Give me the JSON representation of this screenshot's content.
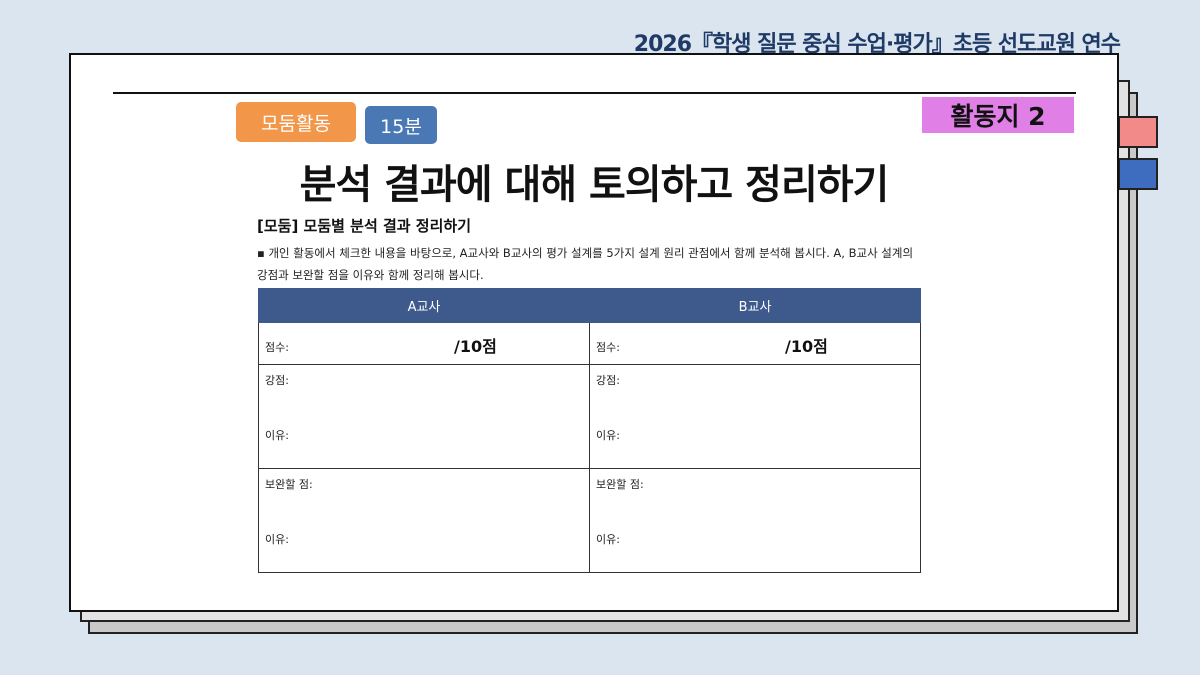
{
  "header": {
    "title": "2026『학생 질문 중심 수업·평가』초등 선도교원 연수"
  },
  "sheet": {
    "activity_label": "모둠활동",
    "time_label": "15분",
    "worksheet_label": "활동지 2",
    "title": "분석 결과에 대해 토의하고 정리하기",
    "section_heading": "[모둠] 모둠별 분석 결과 정리하기",
    "bullet": "▪",
    "description": "개인 활동에서 체크한 내용을 바탕으로, A교사와 B교사의 평가 설계를 5가지 설계 원리 관점에서 함께 분석해 봅시다. A, B교사 설계의 강점과 보완할 점을 이유와 함께 정리해 봅시다."
  },
  "table": {
    "headers": [
      "A교사",
      "B교사"
    ],
    "score_label": "점수:",
    "score_value": "/10점",
    "strength_label": "강점:",
    "reason_label": "이유:",
    "improve_label": "보완할 점:"
  },
  "colors": {
    "background": "#dae5ef",
    "header_text": "#1f3a66",
    "activity_pill": "#f2964a",
    "time_pill": "#4a78b5",
    "worksheet_badge": "#e07fe6",
    "table_header": "#3e5a8c",
    "tab_red": "#f38a8a",
    "tab_blue": "#3e6dbf"
  }
}
